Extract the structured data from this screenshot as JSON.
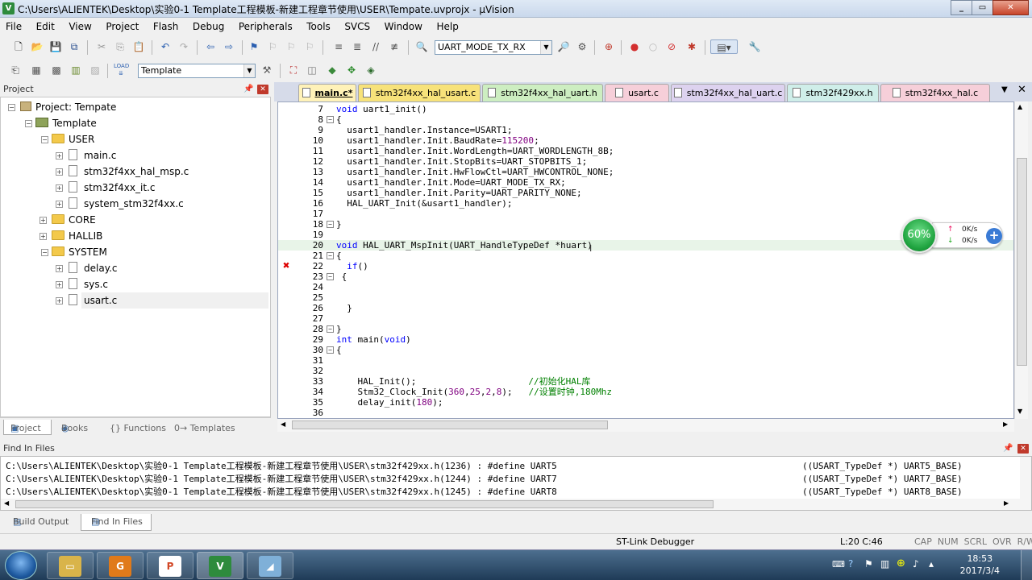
{
  "window": {
    "title": "C:\\Users\\ALIENTEK\\Desktop\\实验0-1 Template工程模板-新建工程章节使用\\USER\\Tempate.uvprojx - µVision"
  },
  "menu": [
    "File",
    "Edit",
    "View",
    "Project",
    "Flash",
    "Debug",
    "Peripherals",
    "Tools",
    "SVCS",
    "Window",
    "Help"
  ],
  "toolbar": {
    "find_combo": "UART_MODE_TX_RX",
    "target_combo": "Template"
  },
  "project_panel": {
    "title": "Project",
    "tree": [
      {
        "label": "Project: Tempate",
        "level": 0
      },
      {
        "label": "Template",
        "level": 1
      },
      {
        "label": "USER",
        "level": 2
      },
      {
        "label": "main.c",
        "level": 3
      },
      {
        "label": "stm32f4xx_hal_msp.c",
        "level": 3
      },
      {
        "label": "stm32f4xx_it.c",
        "level": 3
      },
      {
        "label": "system_stm32f4xx.c",
        "level": 3
      },
      {
        "label": "CORE",
        "level": 2
      },
      {
        "label": "HALLIB",
        "level": 2
      },
      {
        "label": "SYSTEM",
        "level": 2
      },
      {
        "label": "delay.c",
        "level": 3
      },
      {
        "label": "sys.c",
        "level": 3
      },
      {
        "label": "usart.c",
        "level": 3
      }
    ],
    "tabs": [
      "Project",
      "Books",
      "{} Functions",
      "0→ Templates"
    ]
  },
  "editor_tabs": [
    {
      "label": "main.c*",
      "color": "#fde9a6",
      "active": true
    },
    {
      "label": "stm32f4xx_hal_usart.c",
      "color": "#f7e27a"
    },
    {
      "label": "stm32f4xx_hal_uart.h",
      "color": "#cdeec1"
    },
    {
      "label": "usart.c",
      "color": "#f6cfd9"
    },
    {
      "label": "stm32f4xx_hal_uart.c",
      "color": "#ddd2ef"
    },
    {
      "label": "stm32f429xx.h",
      "color": "#cfeee9"
    },
    {
      "label": "stm32f4xx_hal.c",
      "color": "#f6cfd9"
    }
  ],
  "code": [
    {
      "n": "7",
      "text": "void uart1_init()"
    },
    {
      "n": "8",
      "text": "{",
      "fold": true
    },
    {
      "n": "9",
      "text": "  usart1_handler.Instance=USART1;"
    },
    {
      "n": "10",
      "text": "  usart1_handler.Init.BaudRate=115200;"
    },
    {
      "n": "11",
      "text": "  usart1_handler.Init.WordLength=UART_WORDLENGTH_8B;"
    },
    {
      "n": "12",
      "text": "  usart1_handler.Init.StopBits=UART_STOPBITS_1;"
    },
    {
      "n": "13",
      "text": "  usart1_handler.Init.HwFlowCtl=UART_HWCONTROL_NONE;"
    },
    {
      "n": "14",
      "text": "  usart1_handler.Init.Mode=UART_MODE_TX_RX;"
    },
    {
      "n": "15",
      "text": "  usart1_handler.Init.Parity=UART_PARITY_NONE;"
    },
    {
      "n": "16",
      "text": "  HAL_UART_Init(&usart1_handler);"
    },
    {
      "n": "17",
      "text": ""
    },
    {
      "n": "18",
      "text": "}",
      "fold": true
    },
    {
      "n": "19",
      "text": ""
    },
    {
      "n": "20",
      "text": "void HAL_UART_MspInit(UART_HandleTypeDef *huart)",
      "current": true
    },
    {
      "n": "21",
      "text": "{",
      "fold": true
    },
    {
      "n": "22",
      "text": "  if()",
      "error": true
    },
    {
      "n": "23",
      "text": " {",
      "fold": true
    },
    {
      "n": "24",
      "text": ""
    },
    {
      "n": "25",
      "text": ""
    },
    {
      "n": "26",
      "text": "  }"
    },
    {
      "n": "27",
      "text": ""
    },
    {
      "n": "28",
      "text": "}",
      "fold": true
    },
    {
      "n": "29",
      "text": "int main(void)"
    },
    {
      "n": "30",
      "text": "{",
      "fold": true
    },
    {
      "n": "31",
      "text": ""
    },
    {
      "n": "32",
      "text": ""
    },
    {
      "n": "33",
      "text": "    HAL_Init();                     //初始化HAL库"
    },
    {
      "n": "34",
      "text": "    Stm32_Clock_Init(360,25,2,8);   //设置时钟,180Mhz"
    },
    {
      "n": "35",
      "text": "    delay_init(180);"
    },
    {
      "n": "36",
      "text": ""
    }
  ],
  "find_in_files": {
    "title": "Find In Files",
    "results": [
      {
        "path": "C:\\Users\\ALIENTEK\\Desktop\\实验0-1 Template工程模板-新建工程章节使用\\USER\\stm32f429xx.h(1236) : #define UART5",
        "def": "((USART_TypeDef *) UART5_BASE)"
      },
      {
        "path": "C:\\Users\\ALIENTEK\\Desktop\\实验0-1 Template工程模板-新建工程章节使用\\USER\\stm32f429xx.h(1244) : #define UART7",
        "def": "((USART_TypeDef *) UART7_BASE)"
      },
      {
        "path": "C:\\Users\\ALIENTEK\\Desktop\\实验0-1 Template工程模板-新建工程章节使用\\USER\\stm32f429xx.h(1245) : #define UART8",
        "def": "((USART_TypeDef *) UART8_BASE)"
      }
    ],
    "tabs": [
      "Build Output",
      "Find In Files"
    ]
  },
  "status": {
    "debugger": "ST-Link Debugger",
    "position": "L:20 C:46",
    "flags": "CAP  NUM  SCRL  OVR  R/W"
  },
  "net_widget": {
    "percent": "60%",
    "up": "0K/s",
    "down": "0K/s"
  },
  "taskbar": {
    "time": "18:53",
    "date": "2017/3/4"
  }
}
